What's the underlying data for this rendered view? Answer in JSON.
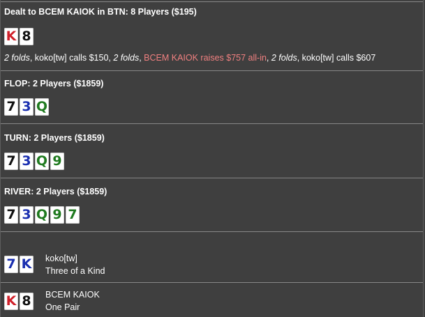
{
  "colors": {
    "background": "#3f3f3f",
    "divider": "#888888",
    "text": "#ffffff",
    "hero_action": "#f08080",
    "suit_hearts": "#d0202a",
    "suit_spades": "#111111",
    "suit_diamonds": "#1a2fb0",
    "suit_clubs": "#1f7a1f"
  },
  "preflop": {
    "header": "Dealt to BCEM KAIOK in BTN: 8 Players ($195)",
    "cards": [
      {
        "rank": "K",
        "suit": "hearts"
      },
      {
        "rank": "8",
        "suit": "spades"
      }
    ],
    "actions": [
      {
        "text": "2 folds",
        "style": "italic"
      },
      {
        "text": ", koko[tw] calls $150, ",
        "style": "normal"
      },
      {
        "text": "2 folds",
        "style": "italic"
      },
      {
        "text": ", ",
        "style": "normal"
      },
      {
        "text": "BCEM KAIOK raises $757 all-in",
        "style": "hero"
      },
      {
        "text": ", ",
        "style": "normal"
      },
      {
        "text": "2 folds",
        "style": "italic"
      },
      {
        "text": ", koko[tw] calls $607",
        "style": "normal"
      }
    ]
  },
  "flop": {
    "header": "FLOP: 2 Players ($1859)",
    "cards": [
      {
        "rank": "7",
        "suit": "spades"
      },
      {
        "rank": "3",
        "suit": "diamonds"
      },
      {
        "rank": "Q",
        "suit": "clubs"
      }
    ]
  },
  "turn": {
    "header": "TURN: 2 Players ($1859)",
    "cards": [
      {
        "rank": "7",
        "suit": "spades"
      },
      {
        "rank": "3",
        "suit": "diamonds"
      },
      {
        "rank": "Q",
        "suit": "clubs"
      },
      {
        "rank": "9",
        "suit": "clubs"
      }
    ]
  },
  "river": {
    "header": "RIVER: 2 Players ($1859)",
    "cards": [
      {
        "rank": "7",
        "suit": "spades"
      },
      {
        "rank": "3",
        "suit": "diamonds"
      },
      {
        "rank": "Q",
        "suit": "clubs"
      },
      {
        "rank": "9",
        "suit": "clubs"
      },
      {
        "rank": "7",
        "suit": "clubs"
      }
    ]
  },
  "showdown": [
    {
      "player": "koko[tw]",
      "hand": "Three of a Kind",
      "cards": [
        {
          "rank": "7",
          "suit": "diamonds"
        },
        {
          "rank": "K",
          "suit": "diamonds"
        }
      ]
    },
    {
      "player": "BCEM KAIOK",
      "hand": "One Pair",
      "cards": [
        {
          "rank": "K",
          "suit": "hearts"
        },
        {
          "rank": "8",
          "suit": "spades"
        }
      ]
    }
  ]
}
